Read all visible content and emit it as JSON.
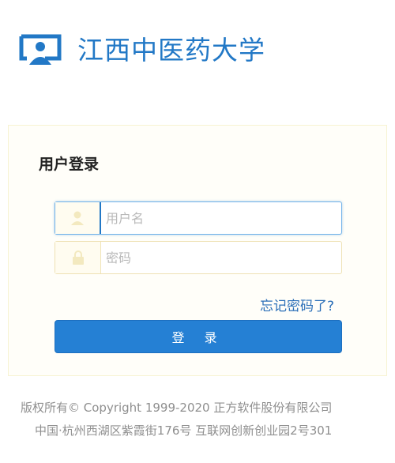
{
  "header": {
    "school_name": "江西中医药大学",
    "logo_icon": "monitor-person-icon",
    "brand_color": "#2278c6"
  },
  "login": {
    "title": "用户登录",
    "username": {
      "placeholder": "用户名",
      "value": "",
      "icon": "user-icon"
    },
    "password": {
      "placeholder": "密码",
      "value": "",
      "icon": "lock-icon"
    },
    "forgot_label": "忘记密码了?",
    "submit_label": "登 录"
  },
  "footer": {
    "copyright": "版权所有© Copyright 1999-2020 正方软件股份有限公司",
    "address": "中国·杭州西湖区紫霞街176号 互联网创新创业园2号301"
  }
}
